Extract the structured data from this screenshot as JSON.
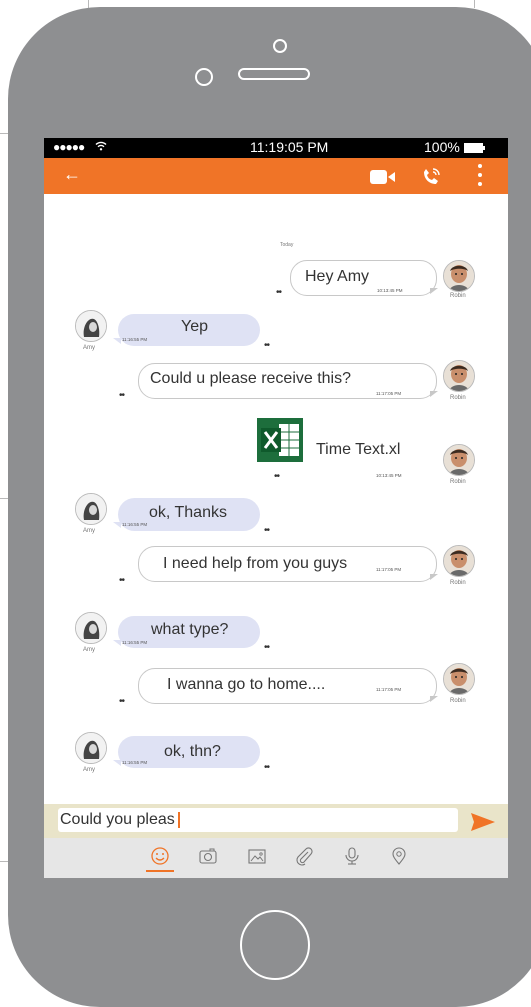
{
  "status": {
    "signal": "●●●●●",
    "time": "11:19:05 PM",
    "battery": "100%"
  },
  "appbar": {
    "back_icon": "arrow-left-icon",
    "video_icon": "video-camera-icon",
    "call_icon": "phone-call-icon",
    "more_icon": "kebab-menu-icon",
    "color": "#f07427"
  },
  "chat": {
    "day_label": "Today",
    "messages": [
      {
        "from": "Robin",
        "text": "Hey Amy",
        "time": "10:13:45 PM"
      },
      {
        "from": "Amy",
        "text": "Yep",
        "time": "11:16:55 PM"
      },
      {
        "from": "Robin",
        "text": "Could u please receive this?",
        "time": "11:17:05 PM"
      },
      {
        "from": "Robin",
        "file": "Time Text.xl",
        "time": "10:13:45 PM"
      },
      {
        "from": "Amy",
        "text": "ok, Thanks",
        "time": "11:16:55 PM"
      },
      {
        "from": "Robin",
        "text": "I need help from you guys",
        "time": "11:17:05 PM"
      },
      {
        "from": "Amy",
        "text": "what type?",
        "time": "11:16:55 PM"
      },
      {
        "from": "Robin",
        "text": "I wanna go to home....",
        "time": "11:17:05 PM"
      },
      {
        "from": "Amy",
        "text": "ok, thn?",
        "time": "11:16:55 PM"
      }
    ],
    "typing": "••"
  },
  "composer": {
    "value": "Could you pleas",
    "send_icon": "send-icon"
  },
  "toolbar": {
    "items": [
      "emoji-icon",
      "camera-icon",
      "image-icon",
      "attachment-icon",
      "microphone-icon",
      "location-icon"
    ],
    "active": "emoji-icon"
  }
}
